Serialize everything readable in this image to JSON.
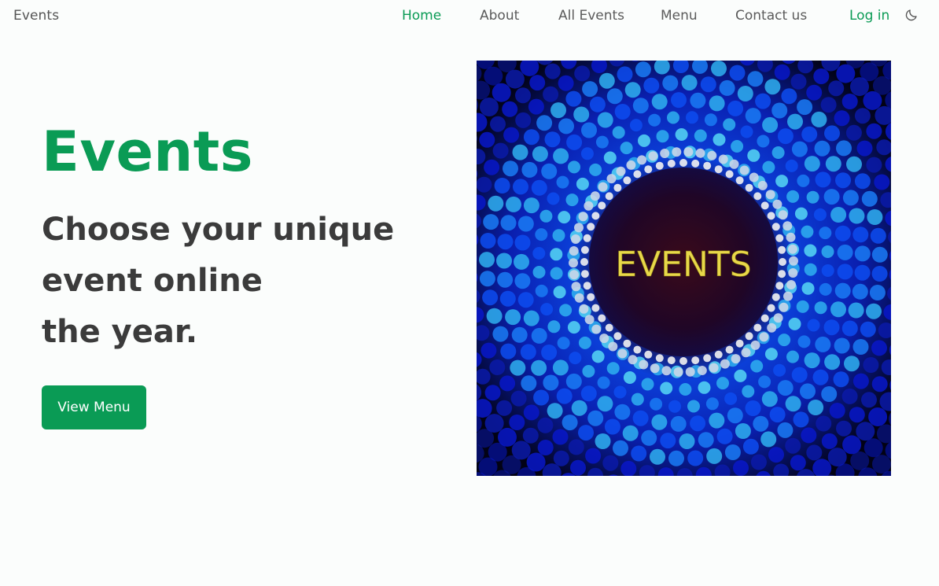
{
  "header": {
    "brand": "Events",
    "nav": [
      {
        "label": "Home",
        "active": true
      },
      {
        "label": "About"
      },
      {
        "label": "All Events"
      },
      {
        "label": "Menu"
      },
      {
        "label": "Contact us"
      }
    ],
    "login_label": "Log in",
    "theme_icon": "moon-icon"
  },
  "hero": {
    "title": "Events",
    "subtitle_lines": [
      "Choose your unique",
      "event online",
      "the year."
    ],
    "cta_label": "View Menu",
    "image_text": "EVENTS"
  },
  "colors": {
    "accent": "#0a9b55",
    "heading": "#3b3b3b",
    "nav_text": "#5b5b5b",
    "background": "#fbfdfc",
    "image_text": "#e8d84a"
  }
}
